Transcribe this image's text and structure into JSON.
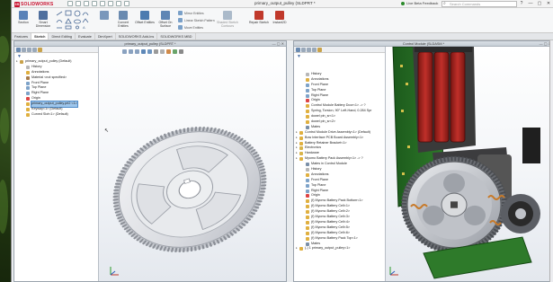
{
  "app": {
    "brand": "SOLIDWORKS",
    "doc_title": "primary_output_pulley (SLDPRT *",
    "feedback_label": "Live Beta Feedback",
    "search_placeholder": "Search Commands",
    "window_controls": [
      "?",
      "—",
      "▢",
      "✕"
    ]
  },
  "command_manager": {
    "buttons": [
      {
        "label": "Section",
        "icon": "section-icon",
        "color": "#5a82b8"
      },
      {
        "label": "Smart Dimension",
        "icon": "smart-dimension-icon",
        "color": "#4f6f9e"
      },
      {
        "label": "Convert Entities",
        "icon": "convert-entities-icon",
        "color": "#6a8ab0"
      },
      {
        "label": "Offset Entities",
        "icon": "offset-entities-icon",
        "color": "#4b7bb0"
      },
      {
        "label": "Offset On Surface",
        "icon": "offset-surface-icon",
        "color": "#5f86b5"
      },
      {
        "label": "Repair Sketch",
        "icon": "repair-sketch-icon",
        "color": "#c0392b"
      },
      {
        "label": "Instant2D",
        "icon": "instant2d-icon",
        "color": "#c0392b"
      },
      {
        "label": "Shaded Sketch Contours",
        "icon": "shaded-contours-icon",
        "color": "#6f8aa6"
      }
    ],
    "small_buttons": [
      {
        "label": "Mirror Entities",
        "icon": "mirror-icon"
      },
      {
        "label": "Linear Sketch Pattern",
        "icon": "linear-pattern-icon"
      },
      {
        "label": "Move Entities",
        "icon": "move-entities-icon"
      }
    ]
  },
  "tabs": [
    {
      "label": "Features",
      "active": false
    },
    {
      "label": "Sketch",
      "active": true
    },
    {
      "label": "Direct Editing",
      "active": false
    },
    {
      "label": "Evaluate",
      "active": false
    },
    {
      "label": "DimXpert",
      "active": false
    },
    {
      "label": "SOLIDWORKS Add-Ins",
      "active": false
    },
    {
      "label": "SOLIDWORKS MBD",
      "active": false
    }
  ],
  "part_window": {
    "title": "primary_output_pulley (SLDPRT *",
    "tree": [
      {
        "label": "primary_output_pulley (Default)",
        "indent": 0,
        "icon": "part-icon",
        "color": "#c9a24a"
      },
      {
        "label": "History",
        "indent": 1,
        "icon": "history-icon",
        "color": "#b7b7b7"
      },
      {
        "label": "Annotations",
        "indent": 1,
        "icon": "annotations-icon",
        "color": "#e0b040"
      },
      {
        "label": "Material <not specified>",
        "indent": 1,
        "icon": "material-icon",
        "color": "#a87b4a"
      },
      {
        "label": "Front Plane",
        "indent": 1,
        "icon": "plane-icon",
        "color": "#7ea3c9"
      },
      {
        "label": "Top Plane",
        "indent": 1,
        "icon": "plane-icon",
        "color": "#7ea3c9"
      },
      {
        "label": "Right Plane",
        "indent": 1,
        "icon": "plane-icon",
        "color": "#7ea3c9"
      },
      {
        "label": "Origin",
        "indent": 1,
        "icon": "origin-icon",
        "color": "#d44"
      },
      {
        "label": "primary_output_pulley.prt2 <1>",
        "indent": 1,
        "icon": "feature-icon",
        "color": "#e0b040",
        "selected": true
      },
      {
        "label": "Keyway<1> (Default)",
        "indent": 1,
        "icon": "feature-icon",
        "color": "#e0b040"
      },
      {
        "label": "Curved Slot<1> (Default)",
        "indent": 1,
        "icon": "feature-icon",
        "color": "#e0b040"
      }
    ]
  },
  "assembly_window": {
    "title": "Control Module (SLDASM *",
    "tree": [
      {
        "label": "History",
        "indent": 1,
        "icon": "history-icon",
        "color": "#b7b7b7"
      },
      {
        "label": "Annotations",
        "indent": 1,
        "icon": "annotations-icon",
        "color": "#e0b040"
      },
      {
        "label": "Front Plane",
        "indent": 1,
        "icon": "plane-icon",
        "color": "#7ea3c9"
      },
      {
        "label": "Top Plane",
        "indent": 1,
        "icon": "plane-icon",
        "color": "#7ea3c9"
      },
      {
        "label": "Right Plane",
        "indent": 1,
        "icon": "plane-icon",
        "color": "#7ea3c9"
      },
      {
        "label": "Origin",
        "indent": 1,
        "icon": "origin-icon",
        "color": "#d44"
      },
      {
        "label": "Control Module Battery Door<1> -> ?",
        "indent": 1,
        "icon": "component-icon",
        "color": "#e0b040"
      },
      {
        "label": "Spring, Torsion, 90° Left-Hand, 0.284 Spr",
        "indent": 1,
        "icon": "component-icon",
        "color": "#e0b040"
      },
      {
        "label": "dowel pin_sr<1>",
        "indent": 1,
        "icon": "component-icon",
        "color": "#e0b040"
      },
      {
        "label": "dowel pin_sr<2>",
        "indent": 1,
        "icon": "component-icon",
        "color": "#e0b040"
      },
      {
        "label": "Mates",
        "indent": 1,
        "icon": "mates-icon",
        "color": "#7a8fa8"
      },
      {
        "label": "Control Module Drive Assembly<1> (Default)",
        "indent": 0,
        "icon": "subassembly-icon",
        "color": "#e0b040"
      },
      {
        "label": "Bow Interface PCB Board Assembly<1>",
        "indent": 0,
        "icon": "subassembly-icon",
        "color": "#e0b040"
      },
      {
        "label": "Battery Retainer Bracket<1>",
        "indent": 0,
        "icon": "component-icon",
        "color": "#e0b040"
      },
      {
        "label": "Electronics",
        "indent": 0,
        "icon": "folder-icon",
        "color": "#d9b44a"
      },
      {
        "label": "Hardware",
        "indent": 0,
        "icon": "folder-icon",
        "color": "#d9b44a"
      },
      {
        "label": "Myomo Battery Pack Assembly<1> -> ?",
        "indent": 0,
        "icon": "subassembly-icon",
        "color": "#e0b040"
      },
      {
        "label": "Mates in Control Module",
        "indent": 1,
        "icon": "mates-icon",
        "color": "#7a8fa8"
      },
      {
        "label": "History",
        "indent": 1,
        "icon": "history-icon",
        "color": "#b7b7b7"
      },
      {
        "label": "Annotations",
        "indent": 1,
        "icon": "annotations-icon",
        "color": "#e0b040"
      },
      {
        "label": "Front Plane",
        "indent": 1,
        "icon": "plane-icon",
        "color": "#7ea3c9"
      },
      {
        "label": "Top Plane",
        "indent": 1,
        "icon": "plane-icon",
        "color": "#7ea3c9"
      },
      {
        "label": "Right Plane",
        "indent": 1,
        "icon": "plane-icon",
        "color": "#7ea3c9"
      },
      {
        "label": "Origin",
        "indent": 1,
        "icon": "origin-icon",
        "color": "#d44"
      },
      {
        "label": "(f) Myomo Battery Pack Bottom<1>",
        "indent": 1,
        "icon": "component-icon",
        "color": "#e0b040"
      },
      {
        "label": "(f) Myomo Battery Cell<1>",
        "indent": 1,
        "icon": "component-icon",
        "color": "#e0b040"
      },
      {
        "label": "(f) Myomo Battery Cell<2>",
        "indent": 1,
        "icon": "component-icon",
        "color": "#e0b040"
      },
      {
        "label": "(f) Myomo Battery Cell<3>",
        "indent": 1,
        "icon": "component-icon",
        "color": "#e0b040"
      },
      {
        "label": "(f) Myomo Battery Cell<4>",
        "indent": 1,
        "icon": "component-icon",
        "color": "#e0b040"
      },
      {
        "label": "(f) Myomo Battery Cell<5>",
        "indent": 1,
        "icon": "component-icon",
        "color": "#e0b040"
      },
      {
        "label": "(f) Myomo Battery Cell<6>",
        "indent": 1,
        "icon": "component-icon",
        "color": "#e0b040"
      },
      {
        "label": "(f) Myomo Battery Pack Top<1>",
        "indent": 1,
        "icon": "component-icon",
        "color": "#e0b040"
      },
      {
        "label": "Mates",
        "indent": 1,
        "icon": "mates-icon",
        "color": "#7a8fa8"
      },
      {
        "label": "(-) 1 primary_output_pulley<1>",
        "indent": 0,
        "icon": "component-icon",
        "color": "#e0b040"
      }
    ]
  },
  "taskpane_icons": [
    {
      "icon": "home-icon",
      "color": "#5a82b8"
    },
    {
      "icon": "resources-icon",
      "color": "#8a6bb0"
    },
    {
      "icon": "design-library-icon",
      "color": "#4aa06a"
    },
    {
      "icon": "file-explorer-icon",
      "color": "#d9a84a"
    },
    {
      "icon": "view-palette-icon",
      "color": "#5a9ac8"
    },
    {
      "icon": "appearances-icon",
      "color": "#c86a4a"
    },
    {
      "icon": "custom-properties-icon",
      "color": "#7a7a7a"
    }
  ]
}
